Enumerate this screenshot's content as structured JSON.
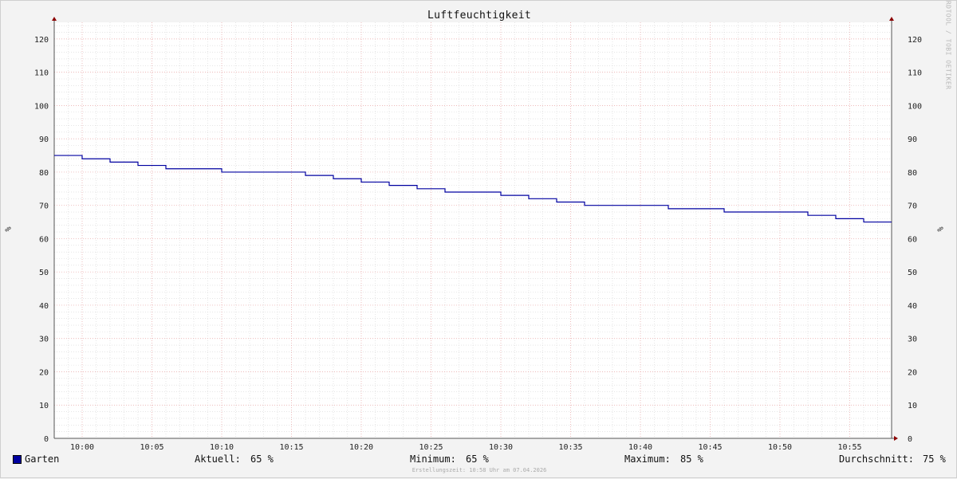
{
  "chart_data": {
    "type": "line",
    "title": "Luftfeuchtigkeit",
    "ylabel": "%",
    "ylabel_right": "%",
    "ylim": [
      0,
      125
    ],
    "yticks": [
      0,
      10,
      20,
      30,
      40,
      50,
      60,
      70,
      80,
      90,
      100,
      110,
      120
    ],
    "xlim": [
      "09:58",
      "10:58"
    ],
    "xticks": [
      "10:00",
      "10:05",
      "10:10",
      "10:15",
      "10:20",
      "10:25",
      "10:30",
      "10:35",
      "10:40",
      "10:45",
      "10:50",
      "10:55"
    ],
    "grid": true,
    "series": [
      {
        "name": "Garten",
        "color": "#0000a0",
        "step": true,
        "x": [
          "09:58",
          "10:00",
          "10:02",
          "10:04",
          "10:06",
          "10:10",
          "10:16",
          "10:18",
          "10:20",
          "10:22",
          "10:24",
          "10:26",
          "10:30",
          "10:32",
          "10:34",
          "10:36",
          "10:42",
          "10:46",
          "10:52",
          "10:54",
          "10:56",
          "10:58"
        ],
        "values": [
          85,
          84,
          83,
          82,
          81,
          80,
          79,
          78,
          77,
          76,
          75,
          74,
          73,
          72,
          71,
          70,
          69,
          68,
          67,
          66,
          65,
          65
        ]
      }
    ]
  },
  "watermark": "RRDTOOL / TOBI OETIKER",
  "legend": {
    "series_label": "Garten",
    "current_label": "Aktuell:",
    "current_value": "65 %",
    "min_label": "Minimum:",
    "min_value": "65 %",
    "max_label": "Maximum:",
    "max_value": "85 %",
    "avg_label": "Durchschnitt:",
    "avg_value": "75 %"
  },
  "footer": "Erstellungszeit: 10:58 Uhr am 07.04.2026"
}
